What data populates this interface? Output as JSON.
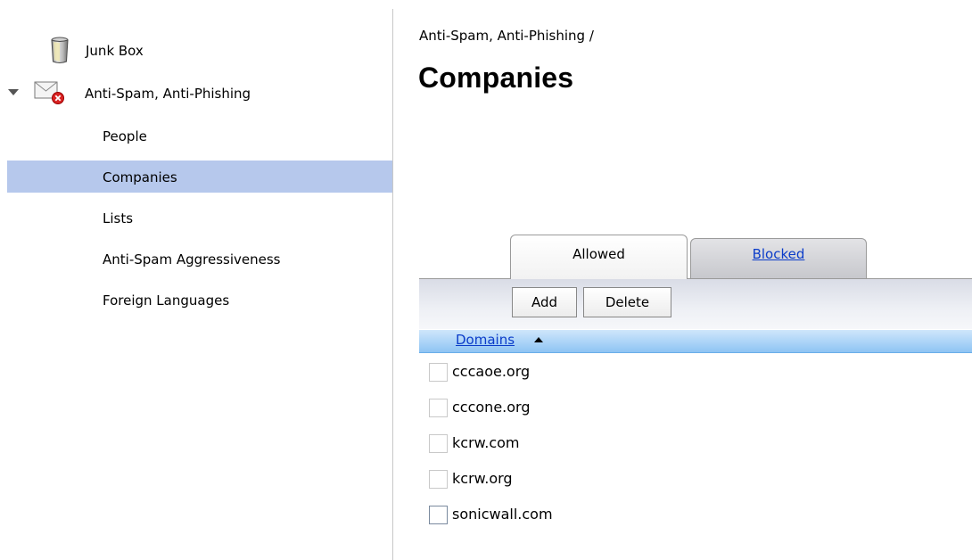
{
  "sidebar": {
    "junk_box": "Junk Box",
    "anti_spam_group": "Anti-Spam, Anti-Phishing",
    "items": [
      {
        "label": "People"
      },
      {
        "label": "Companies"
      },
      {
        "label": "Lists"
      },
      {
        "label": "Anti-Spam Aggressiveness"
      },
      {
        "label": "Foreign Languages"
      }
    ],
    "selected": "Companies"
  },
  "main": {
    "breadcrumb": "Anti-Spam, Anti-Phishing /",
    "title": "Companies",
    "tabs": [
      {
        "label": "Allowed",
        "active": true
      },
      {
        "label": "Blocked",
        "active": false
      }
    ],
    "toolbar": {
      "add_label": "Add",
      "delete_label": "Delete"
    },
    "column_header": "Domains",
    "sort_direction": "ascending",
    "rows": [
      {
        "domain": "cccaoe.org"
      },
      {
        "domain": "cccone.org"
      },
      {
        "domain": "kcrw.com"
      },
      {
        "domain": "kcrw.org"
      },
      {
        "domain": "sonicwall.com"
      }
    ]
  },
  "colors": {
    "selection": "#b6c8ec",
    "link": "#0b3cc9",
    "header_blue": "#a8d2f7"
  },
  "icons": {
    "junk_box": "trash-bin-icon",
    "anti_spam": "envelope-blocked-icon",
    "expand": "triangle-down-icon",
    "sort": "sort-ascending-icon"
  }
}
